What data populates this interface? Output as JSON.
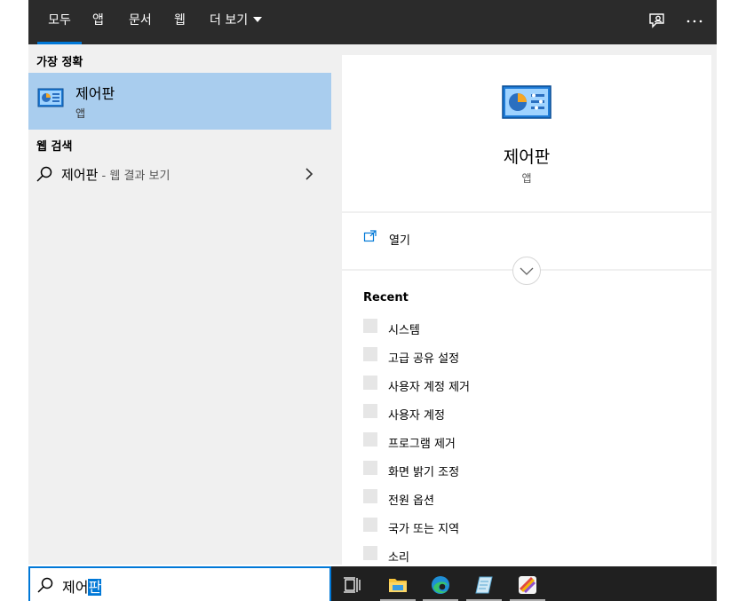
{
  "nav": {
    "tabs": [
      "모두",
      "앱",
      "문서",
      "웹"
    ],
    "more_label": "더 보기",
    "active_tab": 0
  },
  "left": {
    "best_match_label": "가장 정확",
    "best_match": {
      "title": "제어판",
      "subtitle": "앱",
      "icon": "control-panel-icon"
    },
    "web_search_label": "웹 검색",
    "web_result": {
      "query": "제어판",
      "hint": " - 웹 결과 보기"
    }
  },
  "right": {
    "hero": {
      "title": "제어판",
      "subtitle": "앱",
      "icon": "control-panel-icon"
    },
    "open_label": "열기",
    "recent_label": "Recent",
    "recent_items": [
      "시스템",
      "고급 공유 설정",
      "사용자 계정 제거",
      "사용자 계정",
      "프로그램 제거",
      "화면 밝기 조정",
      "전원 옵션",
      "국가 또는 지역",
      "소리"
    ]
  },
  "search": {
    "prefix": "제어",
    "selected": "판"
  },
  "taskbar": {
    "icons": [
      "task-view-icon",
      "file-explorer-icon",
      "edge-icon",
      "notepad-icon",
      "paint-icon"
    ]
  },
  "colors": {
    "accent": "#0078d7",
    "selected_bg": "#a9cdee",
    "topbar_bg": "#2b2b2b",
    "taskbar_bg": "#202020",
    "pane_bg": "#f0f0f0"
  }
}
